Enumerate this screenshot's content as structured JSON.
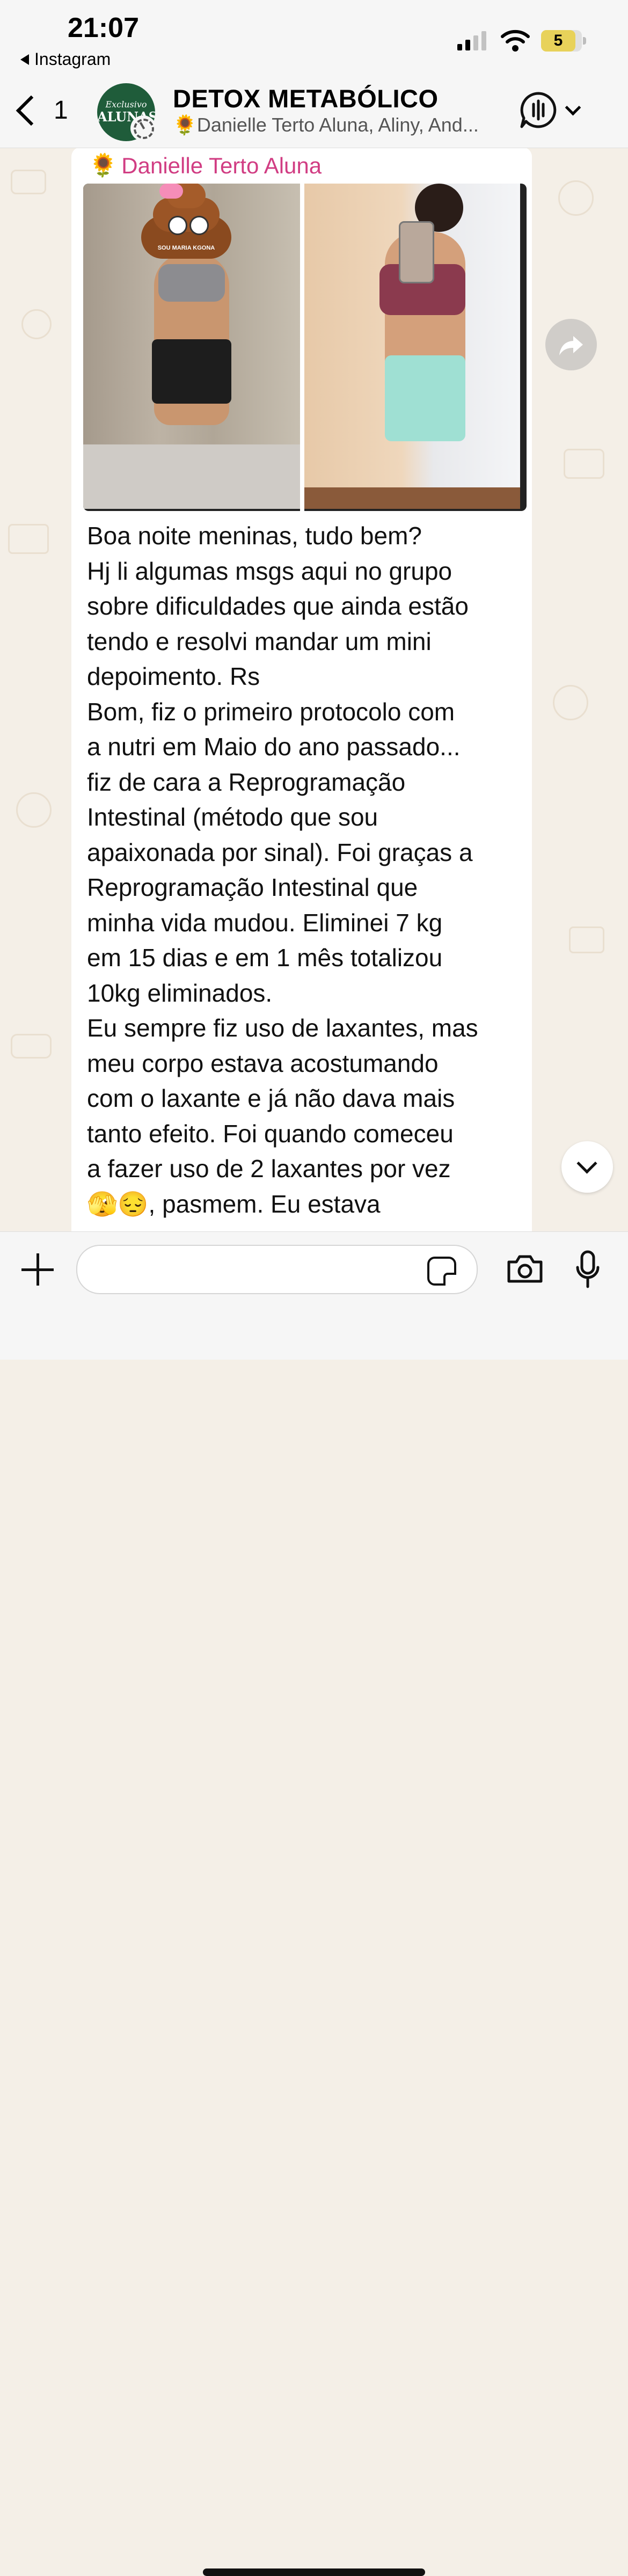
{
  "status_bar": {
    "time": "21:07",
    "back_app": "Instagram",
    "battery": "5"
  },
  "header": {
    "back_count": "1",
    "avatar": {
      "line1": "Exclusivo",
      "line2": "ALUNAS"
    },
    "title": "DETOX METABÓLICO",
    "subtitle": "🌻Danielle Terto Aluna, Aliny, And..."
  },
  "message": {
    "sender_emoji": "🌻",
    "sender": "Danielle Terto Aluna",
    "sticker_label": "SOU MARIA KGONA",
    "lines": [
      "Boa noite meninas, tudo bem?",
      "Hj li algumas msgs aqui no grupo",
      "sobre dificuldades que ainda estão",
      "tendo e resolvi mandar um mini",
      "depoimento. Rs",
      "Bom, fiz o primeiro protocolo com",
      "a nutri em Maio do ano passado...",
      "fiz de cara a Reprogramação",
      "Intestinal (método que sou",
      "apaixonada por sinal). Foi graças a",
      "Reprogramação Intestinal que",
      "minha vida mudou. Eliminei 7 kg",
      "em 15 dias e em 1 mês totalizou",
      "10kg eliminados.",
      "Eu sempre fiz uso de laxantes, mas",
      "meu corpo estava acostumando",
      "com o laxante e já não dava mais",
      "tanto efeito. Foi quando comeceu",
      "a fazer uso de 2 laxantes por vez",
      "🫣😔, pasmem. Eu estava"
    ]
  },
  "icons": {
    "forward": "forward-icon",
    "scroll_down": "chevron-down-icon",
    "attach": "plus-icon",
    "sticker": "sticker-icon",
    "camera": "camera-icon",
    "mic": "microphone-icon"
  },
  "colors": {
    "sender": "#d13d83",
    "chat_bg": "#f4efe7",
    "bubble": "#ffffff"
  }
}
